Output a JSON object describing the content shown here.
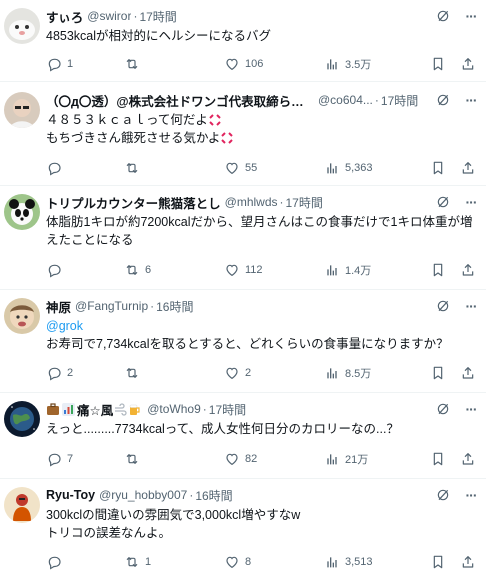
{
  "tweets": [
    {
      "name": "すぃろ",
      "handle": "@swiror",
      "time": "17時間",
      "lines": [
        "4853kcalが相対的にヘルシーになるバグ"
      ],
      "reply": "1",
      "retweet": "",
      "like": "106",
      "views": "3.5万"
    },
    {
      "name": "（〇д〇透）@株式会社ドワンゴ代表取締られ...",
      "handle": "@co604...",
      "time": "17時間",
      "lines": [
        "４８５３ｋｃａｌって何だよ",
        "もちづきさん餓死させる気かよ"
      ],
      "reply": "",
      "retweet": "",
      "like": "55",
      "views": "5,363"
    },
    {
      "name": "トリプルカウンター熊猫落とし",
      "handle": "@mhlwds",
      "time": "17時間",
      "lines": [
        "体脂肪1キロが約7200kcalだから、望月さんはこの食事だけで1キロ体重が増",
        "えたことになる"
      ],
      "reply": "",
      "retweet": "6",
      "like": "112",
      "views": "1.4万"
    },
    {
      "name": "神原",
      "handle": "@FangTurnip",
      "time": "16時間",
      "mention": "@grok",
      "lines": [
        "お寿司で7,734kcalを取るとすると、どれくらいの食事量になりますか？"
      ],
      "reply": "2",
      "retweet": "",
      "like": "2",
      "views": "8.5万"
    },
    {
      "name": "痛☆風",
      "handle": "@toWho9",
      "time": "17時間",
      "lines": [
        "えっと.........7734kcalって、成人女性何日分のカロリーなの...？"
      ],
      "reply": "7",
      "retweet": "",
      "like": "82",
      "views": "21万"
    },
    {
      "name": "Ryu-Toy",
      "handle": "@ryu_hobby007",
      "time": "16時間",
      "lines": [
        "300kclの間違いの雰囲気で3,000kcl増やすなw",
        "トリコの誤差なんよ。"
      ],
      "reply": "",
      "retweet": "1",
      "like": "8",
      "views": "3,513"
    }
  ]
}
